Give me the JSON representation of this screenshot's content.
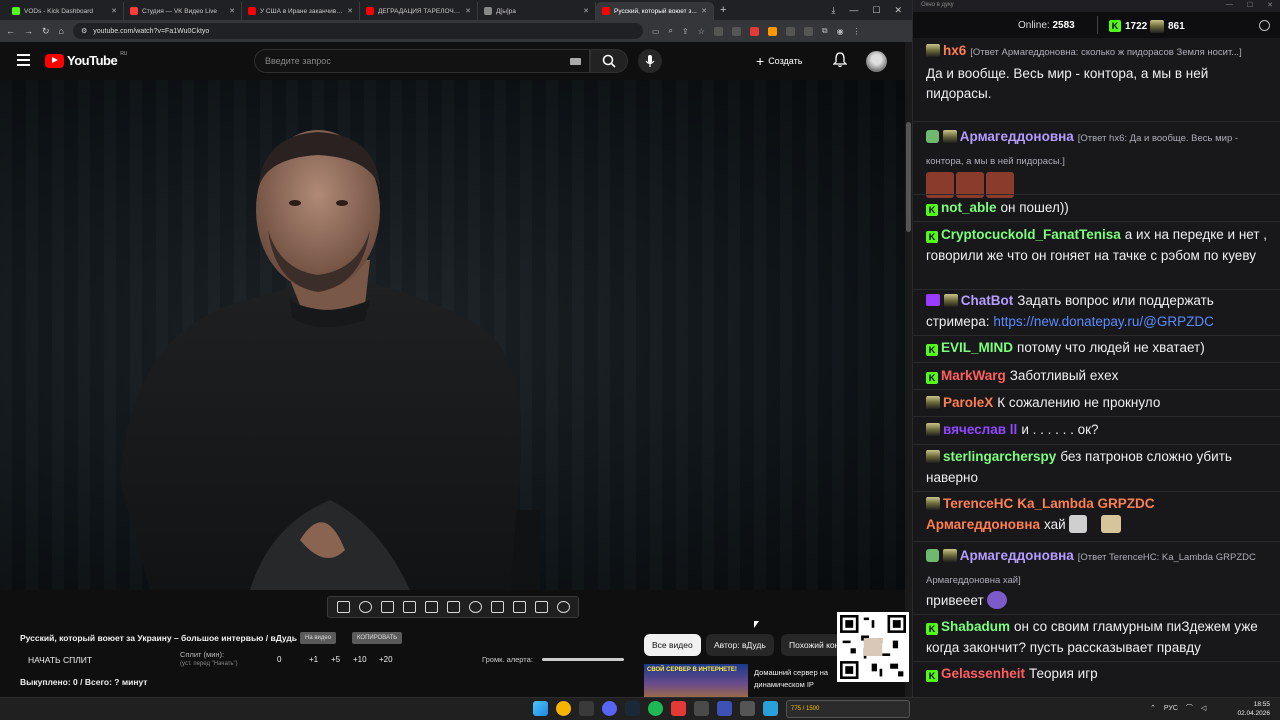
{
  "browser": {
    "tabs": [
      {
        "label": "VODs - Kick Dashboard",
        "color": "#53fc18"
      },
      {
        "label": "Студия — VK Видео Live",
        "color": "#ff3b3b"
      },
      {
        "label": "У США в Иране заканчиваются",
        "color": "#ff0000"
      },
      {
        "label": "ДЕГРАДАЦИЯ ТАРЕЛОЧНИЦ",
        "color": "#ff0000"
      },
      {
        "label": "Д[ы]ра",
        "color": "#888888"
      },
      {
        "label": "Русский, который воюет з...",
        "color": "#ff0000"
      }
    ],
    "new_tab": "+",
    "url": "youtube.com/watch?v=Fa1Wu0Cktyo"
  },
  "youtube": {
    "logo_text": "YouTube",
    "logo_region": "RU",
    "search_placeholder": "Введите запрос",
    "create_label": "Создать"
  },
  "video": {
    "title": "Русский, который воюет за Украину – большое интервью / вДудь",
    "chip_1": "На видео",
    "chip_2": "КОПИРОВАТЬ"
  },
  "panel": {
    "split_button": "НАЧАТЬ СПЛИТ",
    "split_label": "Сплит (мин):",
    "split_sub": "(уст. перед \"Начать\")",
    "split_values": [
      "0",
      "+1",
      "+5",
      "+10",
      "+20"
    ],
    "alert_label": "Громк. алерта:",
    "bought": "Выкуплено: 0 / Всего: ? минут"
  },
  "filters": [
    "Все видео",
    "Автор: вДудь",
    "Похожий контент"
  ],
  "recommendation": {
    "thumb_text": "СВОЙ СЕРВЕР В ИНТЕРНЕТЕ!",
    "title": "Домашний сервер на динамическом IP бесплатно!"
  },
  "chat": {
    "window_title": "Окно в дуку",
    "online_label": "Online:",
    "online_count": "2583",
    "kick_count": "1722",
    "twitch_count": "861",
    "messages": [
      {
        "user": "hx6",
        "color": "#ff7f50",
        "reply": "[Ответ Армагеддоновна: сколько ж пидорасов Земля носит...]",
        "text": "Да и вообще. Весь мир - контора, а мы в ней пидорасы."
      },
      {
        "user": "Армагеддоновна",
        "color": "#b69cff",
        "reply": "[Ответ hx6: Да и вообще. Весь мир - контора, а мы в ней пидорасы.]",
        "text": ""
      },
      {
        "user": "not_able",
        "color": "#7cff7c",
        "text": "он пошел))"
      },
      {
        "user": "Cryptocuckold_FanatTenisa",
        "color": "#7cff7c",
        "text": "а их на передке и нет , говорили же что он гоняет на тачке с рэбом по куеву"
      },
      {
        "user": "ChatBot",
        "color": "#b69cff",
        "text": "Задать вопрос или поддержать стримера:",
        "link": "https://new.donatepay.ru/@GRPZDC"
      },
      {
        "user": "EVIL_MIND",
        "color": "#7cff7c",
        "text": "потому что людей не хватает)"
      },
      {
        "user": "MarkWarg",
        "color": "#ff5f5f",
        "text": "Заботливый exex"
      },
      {
        "user": "ParoleX",
        "color": "#ff7f50",
        "text": "К сожалению не прокнуло"
      },
      {
        "user": "вячеслав ll",
        "color": "#9147ff",
        "text": "и . . . . . . ок?"
      },
      {
        "user": "sterlingarcherspy",
        "color": "#7cff7c",
        "text": "без патронов сложно убить наверно"
      },
      {
        "user": "TerenceHC",
        "color": "#ff7f50",
        "mention": "Ka_Lambda GRPZDC Армагеддоновна",
        "text": "хай"
      },
      {
        "user": "Армагеддоновна",
        "color": "#b69cff",
        "reply": "[Ответ TerenceHC: Ka_Lambda GRPZDC Армагеддоновна хай]",
        "text": "привееет"
      },
      {
        "user": "Shabadum",
        "color": "#7cff7c",
        "text": "он со своим гламурным пиЗдежем уже когда закончит? пусть рассказывает правду"
      },
      {
        "user": "Gelassenheit",
        "color": "#ff5f5f",
        "text": "Теория игр"
      }
    ]
  },
  "taskbar": {
    "widget_text": "775 / 1500",
    "lang": "РУС",
    "time": "18:55",
    "date": "02.04.2026"
  }
}
